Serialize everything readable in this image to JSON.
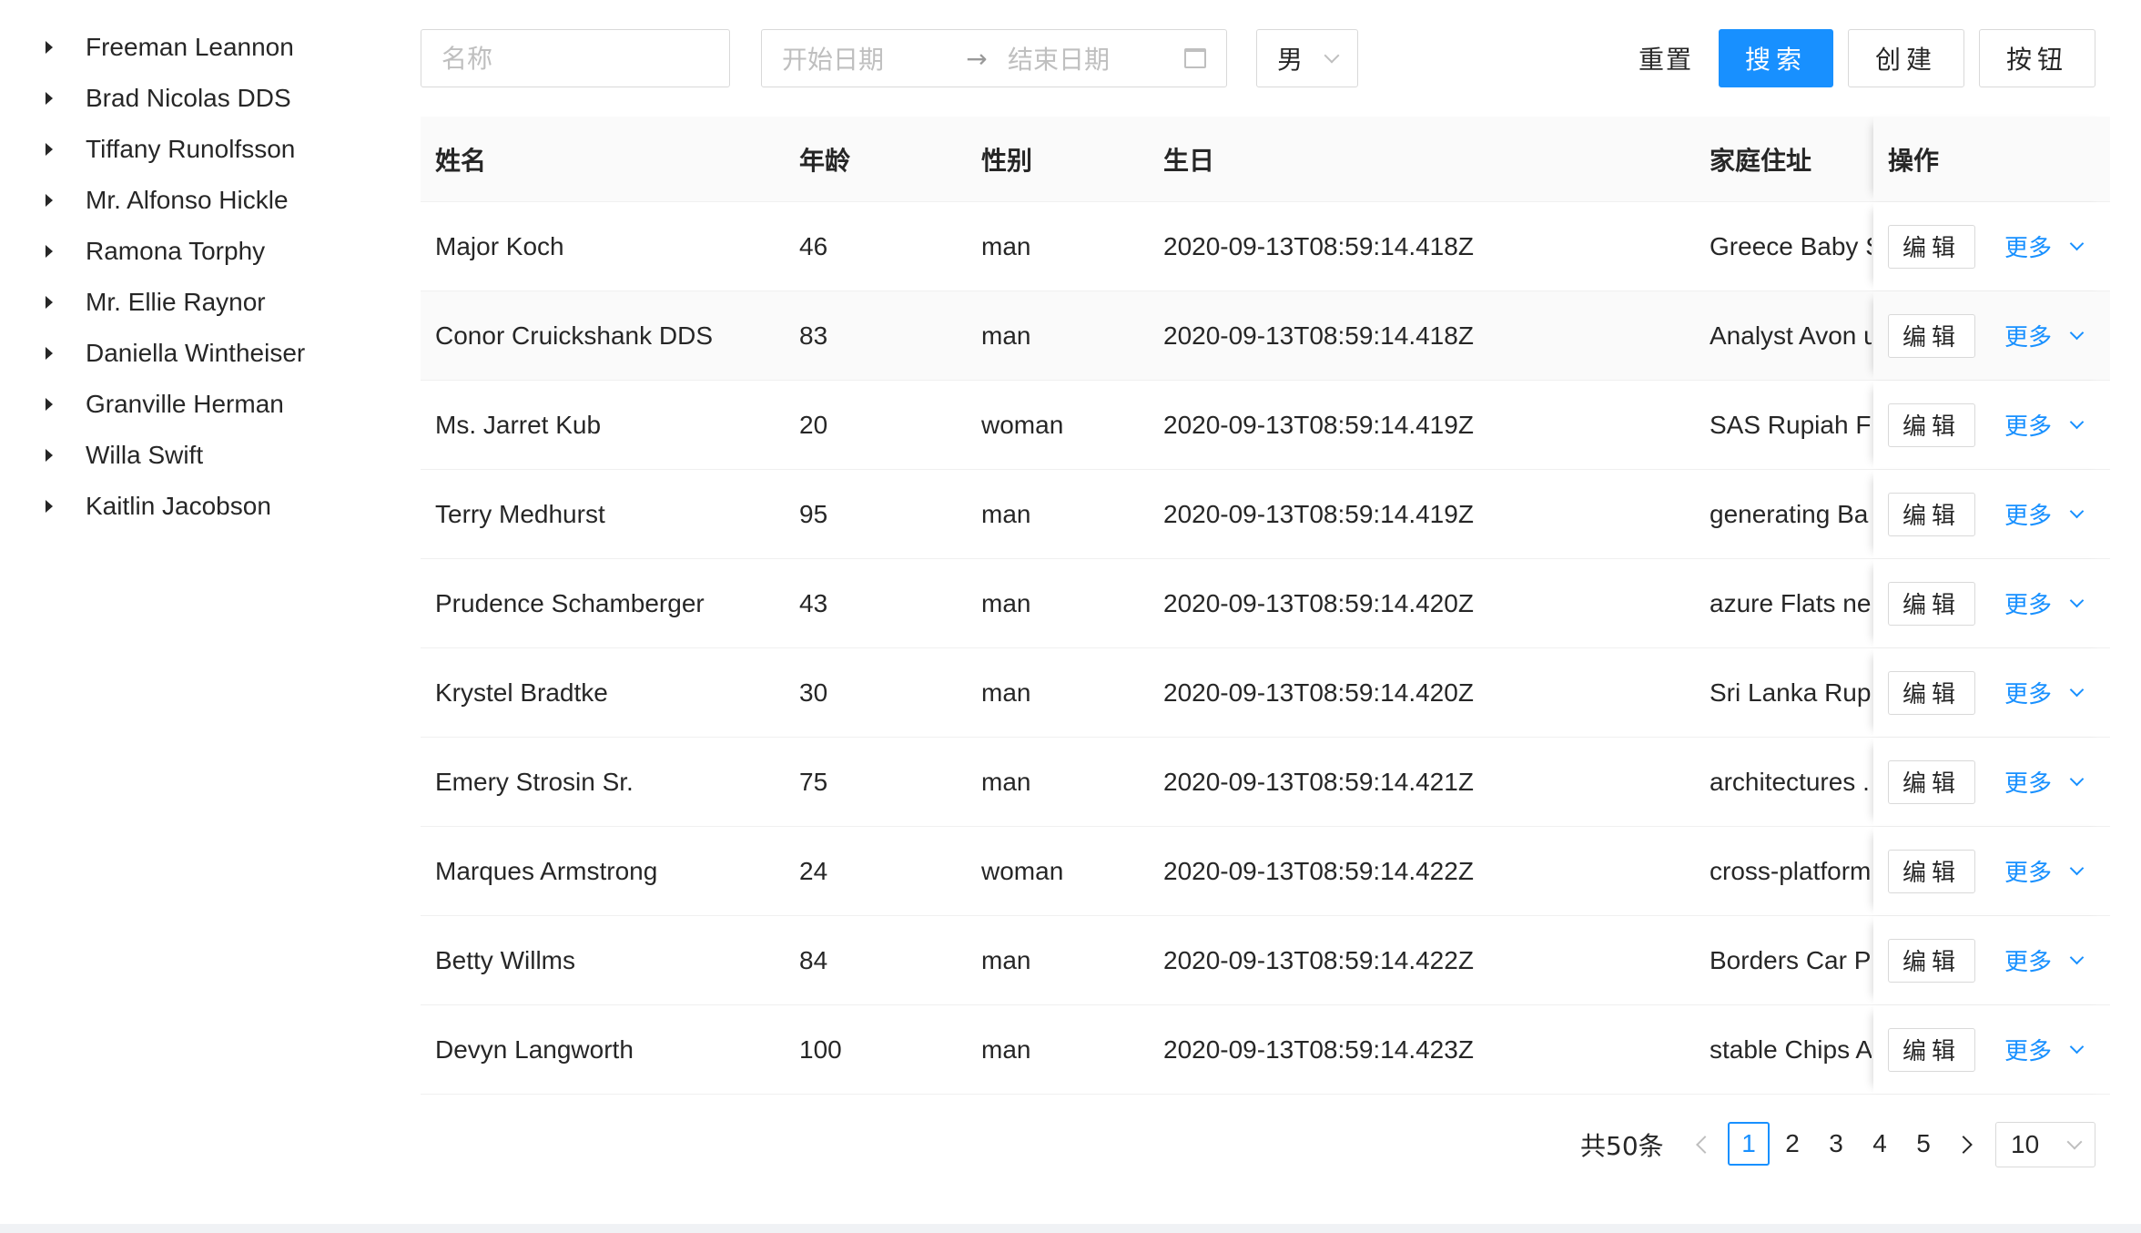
{
  "tree": {
    "items": [
      {
        "label": "Freeman Leannon"
      },
      {
        "label": "Brad Nicolas DDS"
      },
      {
        "label": "Tiffany Runolfsson"
      },
      {
        "label": "Mr. Alfonso Hickle"
      },
      {
        "label": "Ramona Torphy"
      },
      {
        "label": "Mr. Ellie Raynor"
      },
      {
        "label": "Daniella Wintheiser"
      },
      {
        "label": "Granville Herman"
      },
      {
        "label": "Willa Swift"
      },
      {
        "label": "Kaitlin Jacobson"
      }
    ]
  },
  "toolbar": {
    "name_placeholder": "名称",
    "start_date_placeholder": "开始日期",
    "end_date_placeholder": "结束日期",
    "range_separator": "→",
    "gender_value": "男",
    "reset_label": "重置",
    "search_label": "搜索",
    "create_label": "创建",
    "button_label": "按钮",
    "primary_color": "#1890ff"
  },
  "table": {
    "columns": {
      "name": "姓名",
      "age": "年龄",
      "gender": "性别",
      "birthday": "生日",
      "address": "家庭住址",
      "action": "操作"
    },
    "edit_label": "编辑",
    "more_label": "更多",
    "rows": [
      {
        "name": "Major Koch",
        "age": "46",
        "gender": "man",
        "birthday": "2020-09-13T08:59:14.418Z",
        "address": "Greece Baby S"
      },
      {
        "name": "Conor Cruickshank DDS",
        "age": "83",
        "gender": "man",
        "birthday": "2020-09-13T08:59:14.418Z",
        "address": "Analyst Avon u"
      },
      {
        "name": "Ms. Jarret Kub",
        "age": "20",
        "gender": "woman",
        "birthday": "2020-09-13T08:59:14.419Z",
        "address": "SAS Rupiah Fl"
      },
      {
        "name": "Terry Medhurst",
        "age": "95",
        "gender": "man",
        "birthday": "2020-09-13T08:59:14.419Z",
        "address": "generating Ba"
      },
      {
        "name": "Prudence Schamberger",
        "age": "43",
        "gender": "man",
        "birthday": "2020-09-13T08:59:14.420Z",
        "address": "azure Flats ne"
      },
      {
        "name": "Krystel Bradtke",
        "age": "30",
        "gender": "man",
        "birthday": "2020-09-13T08:59:14.420Z",
        "address": "Sri Lanka Rupe"
      },
      {
        "name": "Emery Strosin Sr.",
        "age": "75",
        "gender": "man",
        "birthday": "2020-09-13T08:59:14.421Z",
        "address": "architectures ."
      },
      {
        "name": "Marques Armstrong",
        "age": "24",
        "gender": "woman",
        "birthday": "2020-09-13T08:59:14.422Z",
        "address": "cross-platform"
      },
      {
        "name": "Betty Willms",
        "age": "84",
        "gender": "man",
        "birthday": "2020-09-13T08:59:14.422Z",
        "address": "Borders Car P"
      },
      {
        "name": "Devyn Langworth",
        "age": "100",
        "gender": "man",
        "birthday": "2020-09-13T08:59:14.423Z",
        "address": "stable Chips A"
      }
    ]
  },
  "pagination": {
    "total_label": "共50条",
    "pages": [
      "1",
      "2",
      "3",
      "4",
      "5"
    ],
    "current_page": "1",
    "page_size": "10"
  }
}
